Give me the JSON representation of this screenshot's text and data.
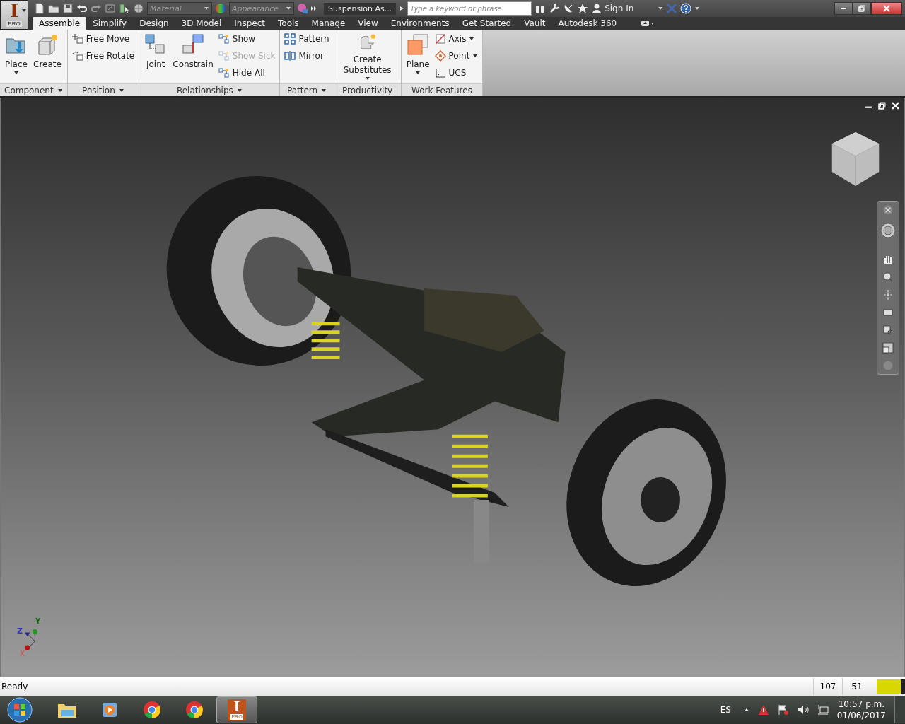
{
  "app_button": {
    "letter": "I",
    "badge": "PRO"
  },
  "quick_access": {
    "material_placeholder": "Material",
    "appearance_placeholder": "Appearance"
  },
  "window": {
    "title": "Suspension As..."
  },
  "search": {
    "placeholder": "Type a keyword or phrase"
  },
  "sign_in": "Sign In",
  "tabs": [
    {
      "label": "Assemble",
      "selected": true
    },
    {
      "label": "Simplify",
      "selected": false
    },
    {
      "label": "Design",
      "selected": false
    },
    {
      "label": "3D Model",
      "selected": false
    },
    {
      "label": "Inspect",
      "selected": false
    },
    {
      "label": "Tools",
      "selected": false
    },
    {
      "label": "Manage",
      "selected": false
    },
    {
      "label": "View",
      "selected": false
    },
    {
      "label": "Environments",
      "selected": false
    },
    {
      "label": "Get Started",
      "selected": false
    },
    {
      "label": "Vault",
      "selected": false
    },
    {
      "label": "Autodesk 360",
      "selected": false
    }
  ],
  "ribbon": [
    {
      "title": "Component",
      "menu": true,
      "tools": [
        {
          "label": "Place",
          "kind": "large",
          "dropdown": true,
          "disabled": false
        },
        {
          "label": "Create",
          "kind": "large",
          "dropdown": false,
          "disabled": false
        }
      ]
    },
    {
      "title": "Position",
      "menu": true,
      "tools": [
        {
          "label": "Free Move",
          "kind": "small",
          "dropdown": false,
          "disabled": false
        },
        {
          "label": "Free Rotate",
          "kind": "small",
          "dropdown": false,
          "disabled": false
        }
      ]
    },
    {
      "title": "Relationships",
      "menu": true,
      "tools": [
        {
          "label": "Joint",
          "kind": "large",
          "dropdown": false,
          "disabled": false
        },
        {
          "label": "Constrain",
          "kind": "large",
          "dropdown": false,
          "disabled": false
        },
        {
          "label": "Show",
          "kind": "small",
          "dropdown": false,
          "disabled": false
        },
        {
          "label": "Show Sick",
          "kind": "small",
          "dropdown": false,
          "disabled": true
        },
        {
          "label": "Hide All",
          "kind": "small",
          "dropdown": false,
          "disabled": false
        }
      ]
    },
    {
      "title": "Pattern",
      "menu": true,
      "tools": [
        {
          "label": "Pattern",
          "kind": "small",
          "dropdown": false,
          "disabled": false
        },
        {
          "label": "Mirror",
          "kind": "small",
          "dropdown": false,
          "disabled": false
        }
      ]
    },
    {
      "title": "Productivity",
      "menu": false,
      "tools": [
        {
          "label": "Create Substitutes",
          "kind": "large",
          "dropdown": true,
          "disabled": false
        }
      ]
    },
    {
      "title": "Work Features",
      "menu": false,
      "tools": [
        {
          "label": "Plane",
          "kind": "large",
          "dropdown": true,
          "disabled": false
        },
        {
          "label": "Axis",
          "kind": "small",
          "dropdown": true,
          "disabled": false
        },
        {
          "label": "Point",
          "kind": "small",
          "dropdown": true,
          "disabled": false
        },
        {
          "label": "UCS",
          "kind": "small",
          "dropdown": false,
          "disabled": false
        }
      ]
    }
  ],
  "triad": {
    "x": "X",
    "y": "Y",
    "z": "Z"
  },
  "status_bar": {
    "message": "Ready",
    "values": [
      "107",
      "51"
    ]
  },
  "taskbar": {
    "apps": [
      {
        "kind": "folder",
        "selected": false
      },
      {
        "kind": "media",
        "selected": false
      },
      {
        "kind": "chrome",
        "selected": false
      },
      {
        "kind": "chrome",
        "selected": false
      },
      {
        "kind": "inventor",
        "selected": true,
        "letter": "I",
        "badge": "PRO"
      }
    ],
    "language": "ES",
    "time": "10:57 p.m.",
    "date": "01/06/2017"
  }
}
